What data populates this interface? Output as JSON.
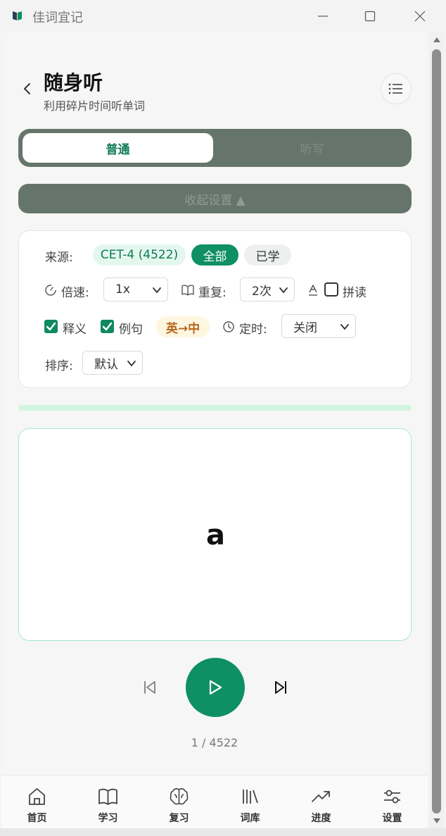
{
  "window": {
    "title": "佳词宜记",
    "controls": {
      "minimize_icon": "minimize-icon",
      "maximize_icon": "maximize-icon",
      "close_icon": "close-icon"
    }
  },
  "header": {
    "title": "随身听",
    "subtitle": "利用碎片时间听单词",
    "back_icon": "chevron-left-icon",
    "menu_icon": "list-icon"
  },
  "mode_tabs": [
    {
      "label": "普通",
      "active": true
    },
    {
      "label": "听写",
      "active": false
    }
  ],
  "collapse_button": {
    "label": "收起设置 ▲"
  },
  "settings": {
    "source_label": "来源:",
    "source_options": [
      "CET-4 (4522)",
      "全部",
      "已学"
    ],
    "source_selected": "全部",
    "speed_label": "倍速:",
    "speed_value": "1x",
    "repeat_label": "重复:",
    "repeat_value": "2次",
    "spell_label": "拼读",
    "spell_checked": false,
    "meaning_label": "释义",
    "meaning_checked": true,
    "example_label": "例句",
    "example_checked": true,
    "direction_label": "英→中",
    "timer_label": "定时:",
    "timer_value": "关闭",
    "sort_label": "排序:",
    "sort_value": "默认"
  },
  "progress": {
    "fraction": 0.0002
  },
  "player": {
    "word": "a",
    "counter": "1 / 4522",
    "prev_icon": "skip-previous-icon",
    "play_icon": "play-icon",
    "next_icon": "skip-next-icon"
  },
  "bottom_nav": [
    {
      "label": "首页",
      "icon": "home-icon"
    },
    {
      "label": "学习",
      "icon": "book-icon"
    },
    {
      "label": "复习",
      "icon": "brain-icon"
    },
    {
      "label": "词库",
      "icon": "library-icon"
    },
    {
      "label": "进度",
      "icon": "trending-up-icon"
    },
    {
      "label": "设置",
      "icon": "sliders-icon"
    }
  ],
  "colors": {
    "accent": "#0e8f64",
    "toggle_bg": "#66756c",
    "progress_bg": "#d2f5e2",
    "card_border": "#a8e8cc",
    "direction_chip_bg": "#fff6e0",
    "direction_chip_text": "#b5651d"
  }
}
